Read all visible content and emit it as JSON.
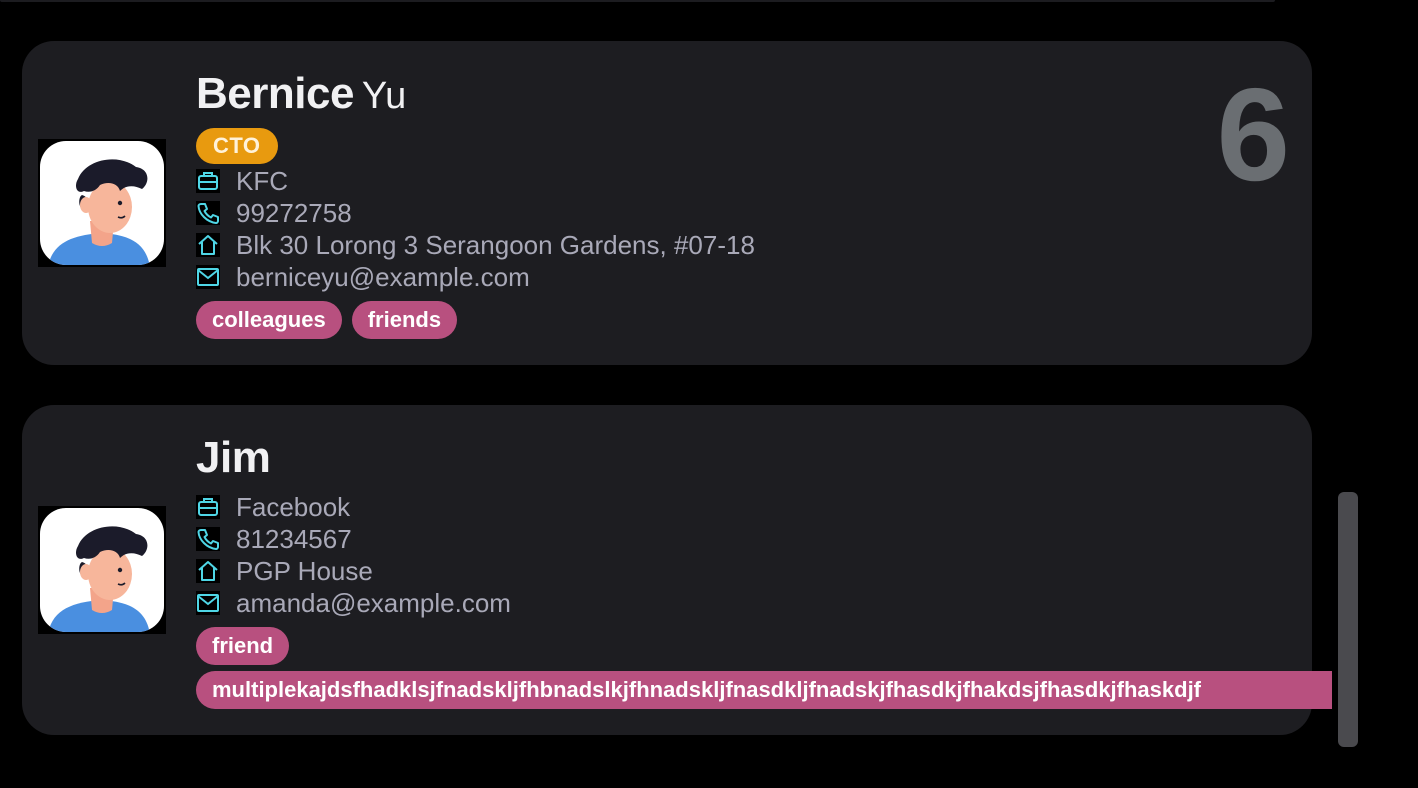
{
  "people": [
    {
      "first_name": "Bernice",
      "last_name": "Yu",
      "role": "CTO",
      "company": "KFC",
      "phone": "99272758",
      "address": "Blk 30 Lorong 3 Serangoon Gardens, #07-18",
      "email": "berniceyu@example.com",
      "tags": [
        "colleagues",
        "friends"
      ],
      "index": "6"
    },
    {
      "first_name": "Jim",
      "company": "Facebook",
      "phone": "81234567",
      "address": "PGP House",
      "email": "amanda@example.com",
      "tags": [
        "friend",
        "multiplekajdsfhadklsjfnadskljfhbnadslkjfhnadskljfnasdkljfnadskjfhasdkjfhakdsjfhasdkjfhaskdjf"
      ]
    }
  ],
  "icons": {
    "company": "briefcase-icon",
    "phone": "phone-icon",
    "address": "home-icon",
    "email": "mail-icon"
  },
  "colors": {
    "background": "#000000",
    "card": "#1d1d21",
    "role_badge": "#e89a0f",
    "tag": "#b8507f",
    "icon": "#4fd6e6",
    "index_number": "#6a6e72"
  }
}
